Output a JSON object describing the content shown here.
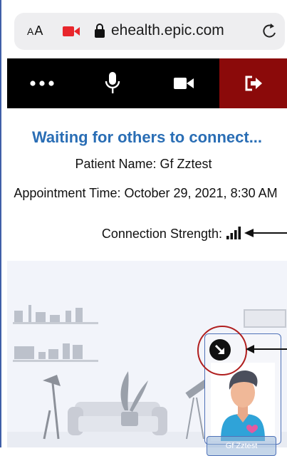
{
  "browser": {
    "aa_label_small": "A",
    "aa_label_large": "A",
    "domain": "ehealth.epic.com"
  },
  "toolbar": {
    "more_icon": "more-icon",
    "mic_icon": "microphone-icon",
    "video_icon": "video-camera-icon",
    "leave_icon": "leave-icon",
    "leave_color": "#8b0a0a"
  },
  "status": {
    "title": "Waiting for others to connect...",
    "patient": "Patient Name: Gf Zztest",
    "appointment": "Appointment Time: October 29, 2021, 8:30 AM",
    "connection": "Connection Strength:"
  },
  "self_view": {
    "name": "Gf Zztest"
  },
  "colors": {
    "title_blue": "#2a6eb5",
    "highlight_red": "#b01e1e",
    "frame_blue": "#4f72b8"
  }
}
